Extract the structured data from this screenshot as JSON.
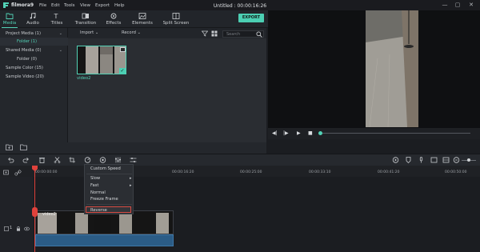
{
  "app": {
    "name": "filmora9",
    "window_title": "Untitled : 00:00:16:26"
  },
  "menubar": {
    "items": [
      "File",
      "Edit",
      "Tools",
      "View",
      "Export",
      "Help"
    ]
  },
  "tabs": [
    {
      "label": "Media",
      "icon": "folder-icon",
      "active": true
    },
    {
      "label": "Audio",
      "icon": "music-note-icon",
      "active": false
    },
    {
      "label": "Titles",
      "icon": "text-icon",
      "active": false
    },
    {
      "label": "Transition",
      "icon": "transition-icon",
      "active": false
    },
    {
      "label": "Effects",
      "icon": "effects-icon",
      "active": false
    },
    {
      "label": "Elements",
      "icon": "elements-icon",
      "active": false
    },
    {
      "label": "Split Screen",
      "icon": "split-screen-icon",
      "active": false
    }
  ],
  "export_label": "EXPORT",
  "sidebar": {
    "items": [
      {
        "label": "Project Media (1)",
        "active": false,
        "caret": "⌄"
      },
      {
        "label": "Folder (1)",
        "active": true,
        "sub": true
      },
      {
        "label": "Shared Media (0)",
        "active": false,
        "caret": "⌄"
      },
      {
        "label": "Folder (0)",
        "active": false,
        "sub": true
      },
      {
        "label": "Sample Color (15)",
        "active": false
      },
      {
        "label": "Sample Video (20)",
        "active": false
      }
    ]
  },
  "media_toolbar": {
    "import_label": "Import",
    "record_label": "Record",
    "search_placeholder": "Search"
  },
  "media_items": [
    {
      "label": "video2",
      "selected": true
    }
  ],
  "timeline": {
    "ruler_ticks": [
      "00:00:00:00",
      "00:00:16:20",
      "00:00:25:00",
      "00:00:33:10",
      "00:00:41:20",
      "00:00:50:00"
    ],
    "track_number": "1",
    "clip_title": "video2"
  },
  "context_menu": {
    "items": [
      "Custom Speed",
      "Slow",
      "Fast",
      "Normal",
      "Freeze Frame",
      "Reverse"
    ],
    "highlighted": "Reverse"
  },
  "colors": {
    "accent": "#52d2b6",
    "playhead": "#e0423c",
    "audio_track": "#2b5c86"
  }
}
